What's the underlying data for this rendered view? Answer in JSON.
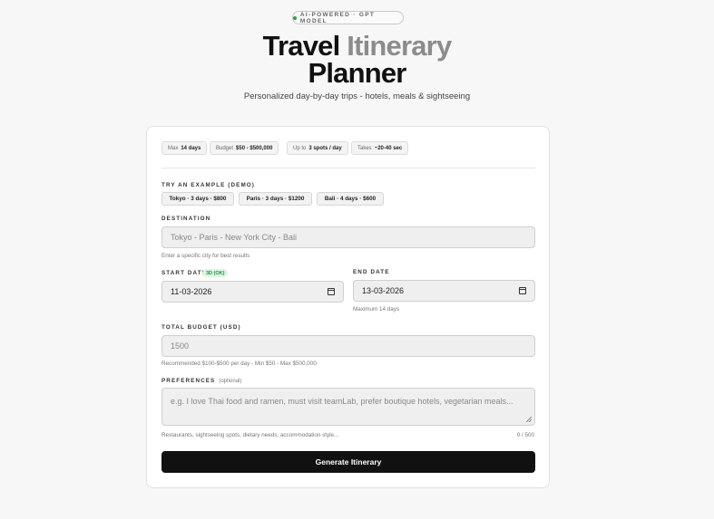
{
  "badge": {
    "text": "AI-POWERED · GPT MODEL"
  },
  "title": {
    "part1": "Travel ",
    "part2": "Itinerary",
    "line2": "Planner"
  },
  "subtitle": "Personalized day-by-day trips - hotels, meals & sightseeing",
  "limits": [
    {
      "prefix": "Max",
      "value": "14 days"
    },
    {
      "prefix": "Budget",
      "value": "$50 - $500,000"
    },
    {
      "prefix": "Up to",
      "value": "3 spots / day"
    },
    {
      "prefix": "Takes",
      "value": "~20-40 sec"
    }
  ],
  "examples": {
    "label": "TRY AN EXAMPLE (DEMO)",
    "items": [
      "Tokyo · 3 days · $800",
      "Paris · 3 days · $1200",
      "Bali · 4 days · $600"
    ]
  },
  "destination": {
    "label": "DESTINATION",
    "placeholder": "Tokyo - Paris - New York City - Bali",
    "hint": "Enter a specific city for best results"
  },
  "start_date": {
    "label": "START DATE",
    "status": "3D (OK)",
    "value": "11-03-2026"
  },
  "end_date": {
    "label": "END DATE",
    "value": "13-03-2026",
    "hint": "Maximum 14 days"
  },
  "budget": {
    "label": "TOTAL BUDGET (USD)",
    "value": "1500",
    "hint": "Recommended $100-$500 per day - Min $50 - Max $500,000"
  },
  "preferences": {
    "label": "PREFERENCES",
    "optional": "(optional)",
    "placeholder": "e.g. I love Thai food and ramen, must visit teamLab, prefer boutique hotels, vegetarian meals...",
    "hint": "Restaurants, sightseeing spots, dietary needs, accommodation style...",
    "counter": "0 / 500"
  },
  "submit_label": "Generate Itinerary",
  "colors": {
    "accent": "#111111",
    "ok": "#2b8a45",
    "title_grey": "#8c8c8c"
  }
}
